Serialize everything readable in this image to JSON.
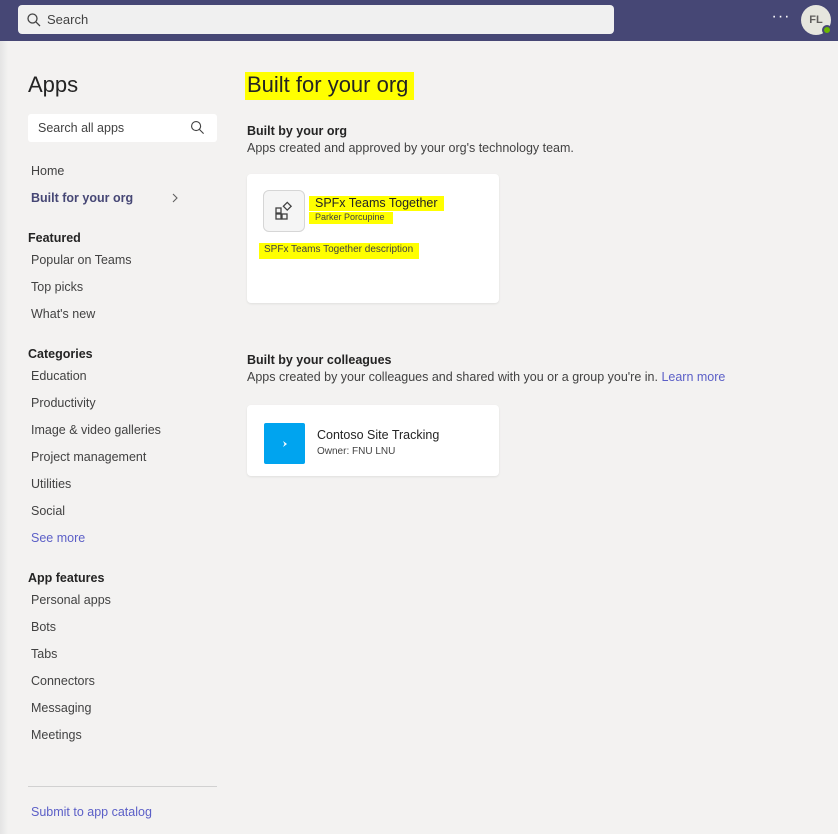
{
  "topbar": {
    "search_placeholder": "Search",
    "more_label": "···",
    "avatar_initials": "FL"
  },
  "sidebar": {
    "title": "Apps",
    "search_placeholder": "Search all apps",
    "home": "Home",
    "built_for_org": "Built for your org",
    "featured_heading": "Featured",
    "featured": [
      "Popular on Teams",
      "Top picks",
      "What's new"
    ],
    "categories_heading": "Categories",
    "categories": [
      "Education",
      "Productivity",
      "Image & video galleries",
      "Project management",
      "Utilities",
      "Social"
    ],
    "see_more": "See more",
    "app_features_heading": "App features",
    "app_features": [
      "Personal apps",
      "Bots",
      "Tabs",
      "Connectors",
      "Messaging",
      "Meetings"
    ],
    "submit": "Submit to app catalog"
  },
  "main": {
    "title": "Built for your org",
    "org_section": {
      "title": "Built by your org",
      "desc": "Apps created and approved by your org's technology team.",
      "app": {
        "name": "SPFx Teams Together",
        "publisher": "Parker Porcupine",
        "description": "SPFx Teams Together description"
      }
    },
    "colleagues_section": {
      "title": "Built by your colleagues",
      "desc": "Apps created by your colleagues and shared with you or a group you're in.",
      "learn_more": "Learn more",
      "app": {
        "name": "Contoso Site Tracking",
        "owner": "Owner: FNU LNU"
      }
    }
  },
  "colors": {
    "topbar": "#464775",
    "accent": "#5b5fc7",
    "highlight": "#ffff00",
    "app_tile": "#00a4ef",
    "presence": "#6bb700"
  }
}
